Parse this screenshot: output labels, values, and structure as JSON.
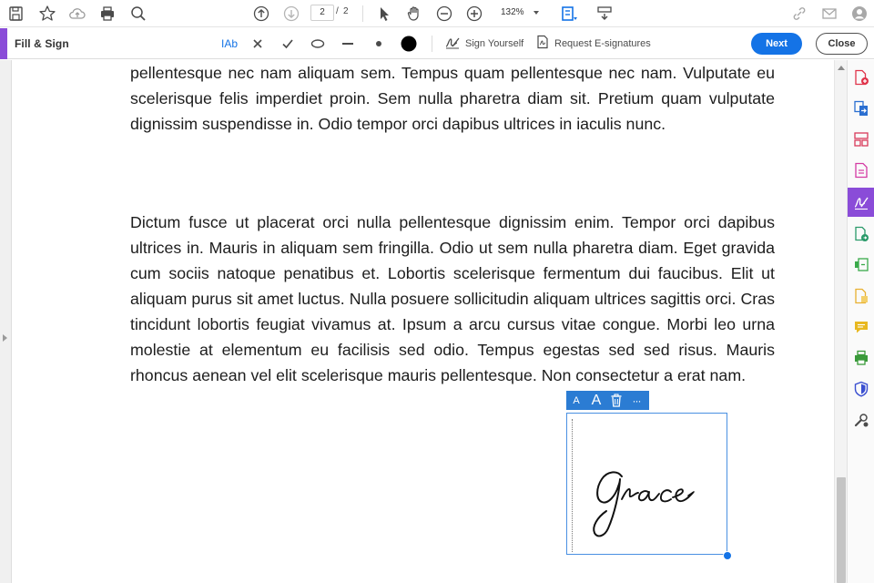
{
  "toolbar": {
    "current_page": "2",
    "page_separator": "/",
    "total_pages": "2",
    "zoom": "132%"
  },
  "fill_sign": {
    "title": "Fill & Sign",
    "text_tool_label": "IAb",
    "sign_yourself": "Sign Yourself",
    "request_esignatures": "Request E-signatures",
    "next": "Next",
    "close": "Close"
  },
  "document": {
    "paragraph1": "pellentesque nec nam aliquam sem. Tempus quam pellentesque nec nam. Vulputate eu scelerisque felis imperdiet proin. Sem nulla pharetra diam sit. Pretium quam vulputate dignissim suspendisse in. Odio tempor orci dapibus ultrices in iaculis nunc.",
    "paragraph2": "Dictum fusce ut placerat orci nulla pellentesque dignissim enim. Tempor orci dapibus ultrices in. Mauris in aliquam sem fringilla. Odio ut sem nulla pharetra diam. Eget gravida cum sociis natoque penatibus et. Lobortis scelerisque fermentum dui faucibus. Elit ut aliquam purus sit amet luctus. Nulla posuere sollicitudin aliquam ultrices sagittis orci. Cras tincidunt lobortis feugiat vivamus at. Ipsum a arcu cursus vitae congue. Morbi leo urna molestie at elementum eu facilisis sed odio. Tempus egestas sed sed risus. Mauris rhoncus aenean vel elit scelerisque mauris pellentesque. Non consectetur a erat nam."
  },
  "signature": {
    "signed_name": "Grace",
    "decrease_font_label": "A",
    "increase_font_label": "A",
    "more_label": "···"
  },
  "colors": {
    "accent_purple": "#8a4cd8",
    "primary_blue": "#1473e6",
    "signature_blue": "#2b7cd3"
  },
  "icons": {
    "top_left": [
      "save-icon",
      "bookmark-star-icon",
      "upload-cloud-icon",
      "print-icon",
      "search-icon"
    ],
    "navigation": [
      "page-up-icon",
      "page-down-icon"
    ],
    "tools": [
      "select-cursor-icon",
      "hand-tool-icon",
      "zoom-out-icon",
      "zoom-in-icon",
      "fit-page-icon",
      "scroll-mode-icon"
    ],
    "top_right": [
      "share-link-icon",
      "email-icon",
      "account-icon"
    ],
    "fill_sign_tools": [
      "text-tool-icon",
      "cross-mark-icon",
      "check-mark-icon",
      "ellipse-icon",
      "line-icon",
      "dot-icon",
      "color-swatch-icon",
      "sign-yourself-icon",
      "request-esignatures-icon"
    ],
    "right_rail": [
      "create-pdf-icon",
      "export-pdf-icon",
      "organize-pages-icon",
      "edit-pdf-icon",
      "fill-sign-icon",
      "send-for-signature-icon",
      "compress-pdf-icon",
      "scan-ocr-icon",
      "comment-icon",
      "print-production-icon",
      "protect-icon",
      "more-tools-icon"
    ]
  }
}
